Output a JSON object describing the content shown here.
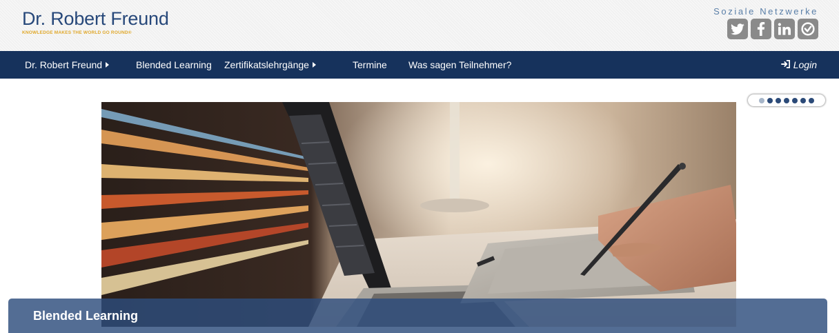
{
  "header": {
    "logo_name": "Dr. Robert Freund",
    "logo_tagline": "KNOWLEDGE MAKES THE WORLD GO ROUND®",
    "social_title": "Soziale Netzwerke",
    "social_icons": [
      "twitter-icon",
      "facebook-icon",
      "linkedin-icon",
      "xing-icon"
    ]
  },
  "nav": {
    "items": [
      {
        "label": "Dr. Robert Freund",
        "has_submenu": true
      },
      {
        "label": "Blended Learning",
        "has_submenu": false
      },
      {
        "label": "Zertifikatslehrgänge",
        "has_submenu": true
      },
      {
        "label": "Termine",
        "has_submenu": false
      },
      {
        "label": "Was sagen Teilnehmer?",
        "has_submenu": false
      }
    ],
    "login_label": "Login"
  },
  "slider": {
    "slide_count": 7,
    "active_index": 0,
    "caption": "Blended Learning"
  },
  "colors": {
    "brand_blue": "#27487a",
    "nav_background": "#16325c",
    "tagline_gold": "#e0a82a",
    "caption_bar": "#2d4d7d"
  }
}
